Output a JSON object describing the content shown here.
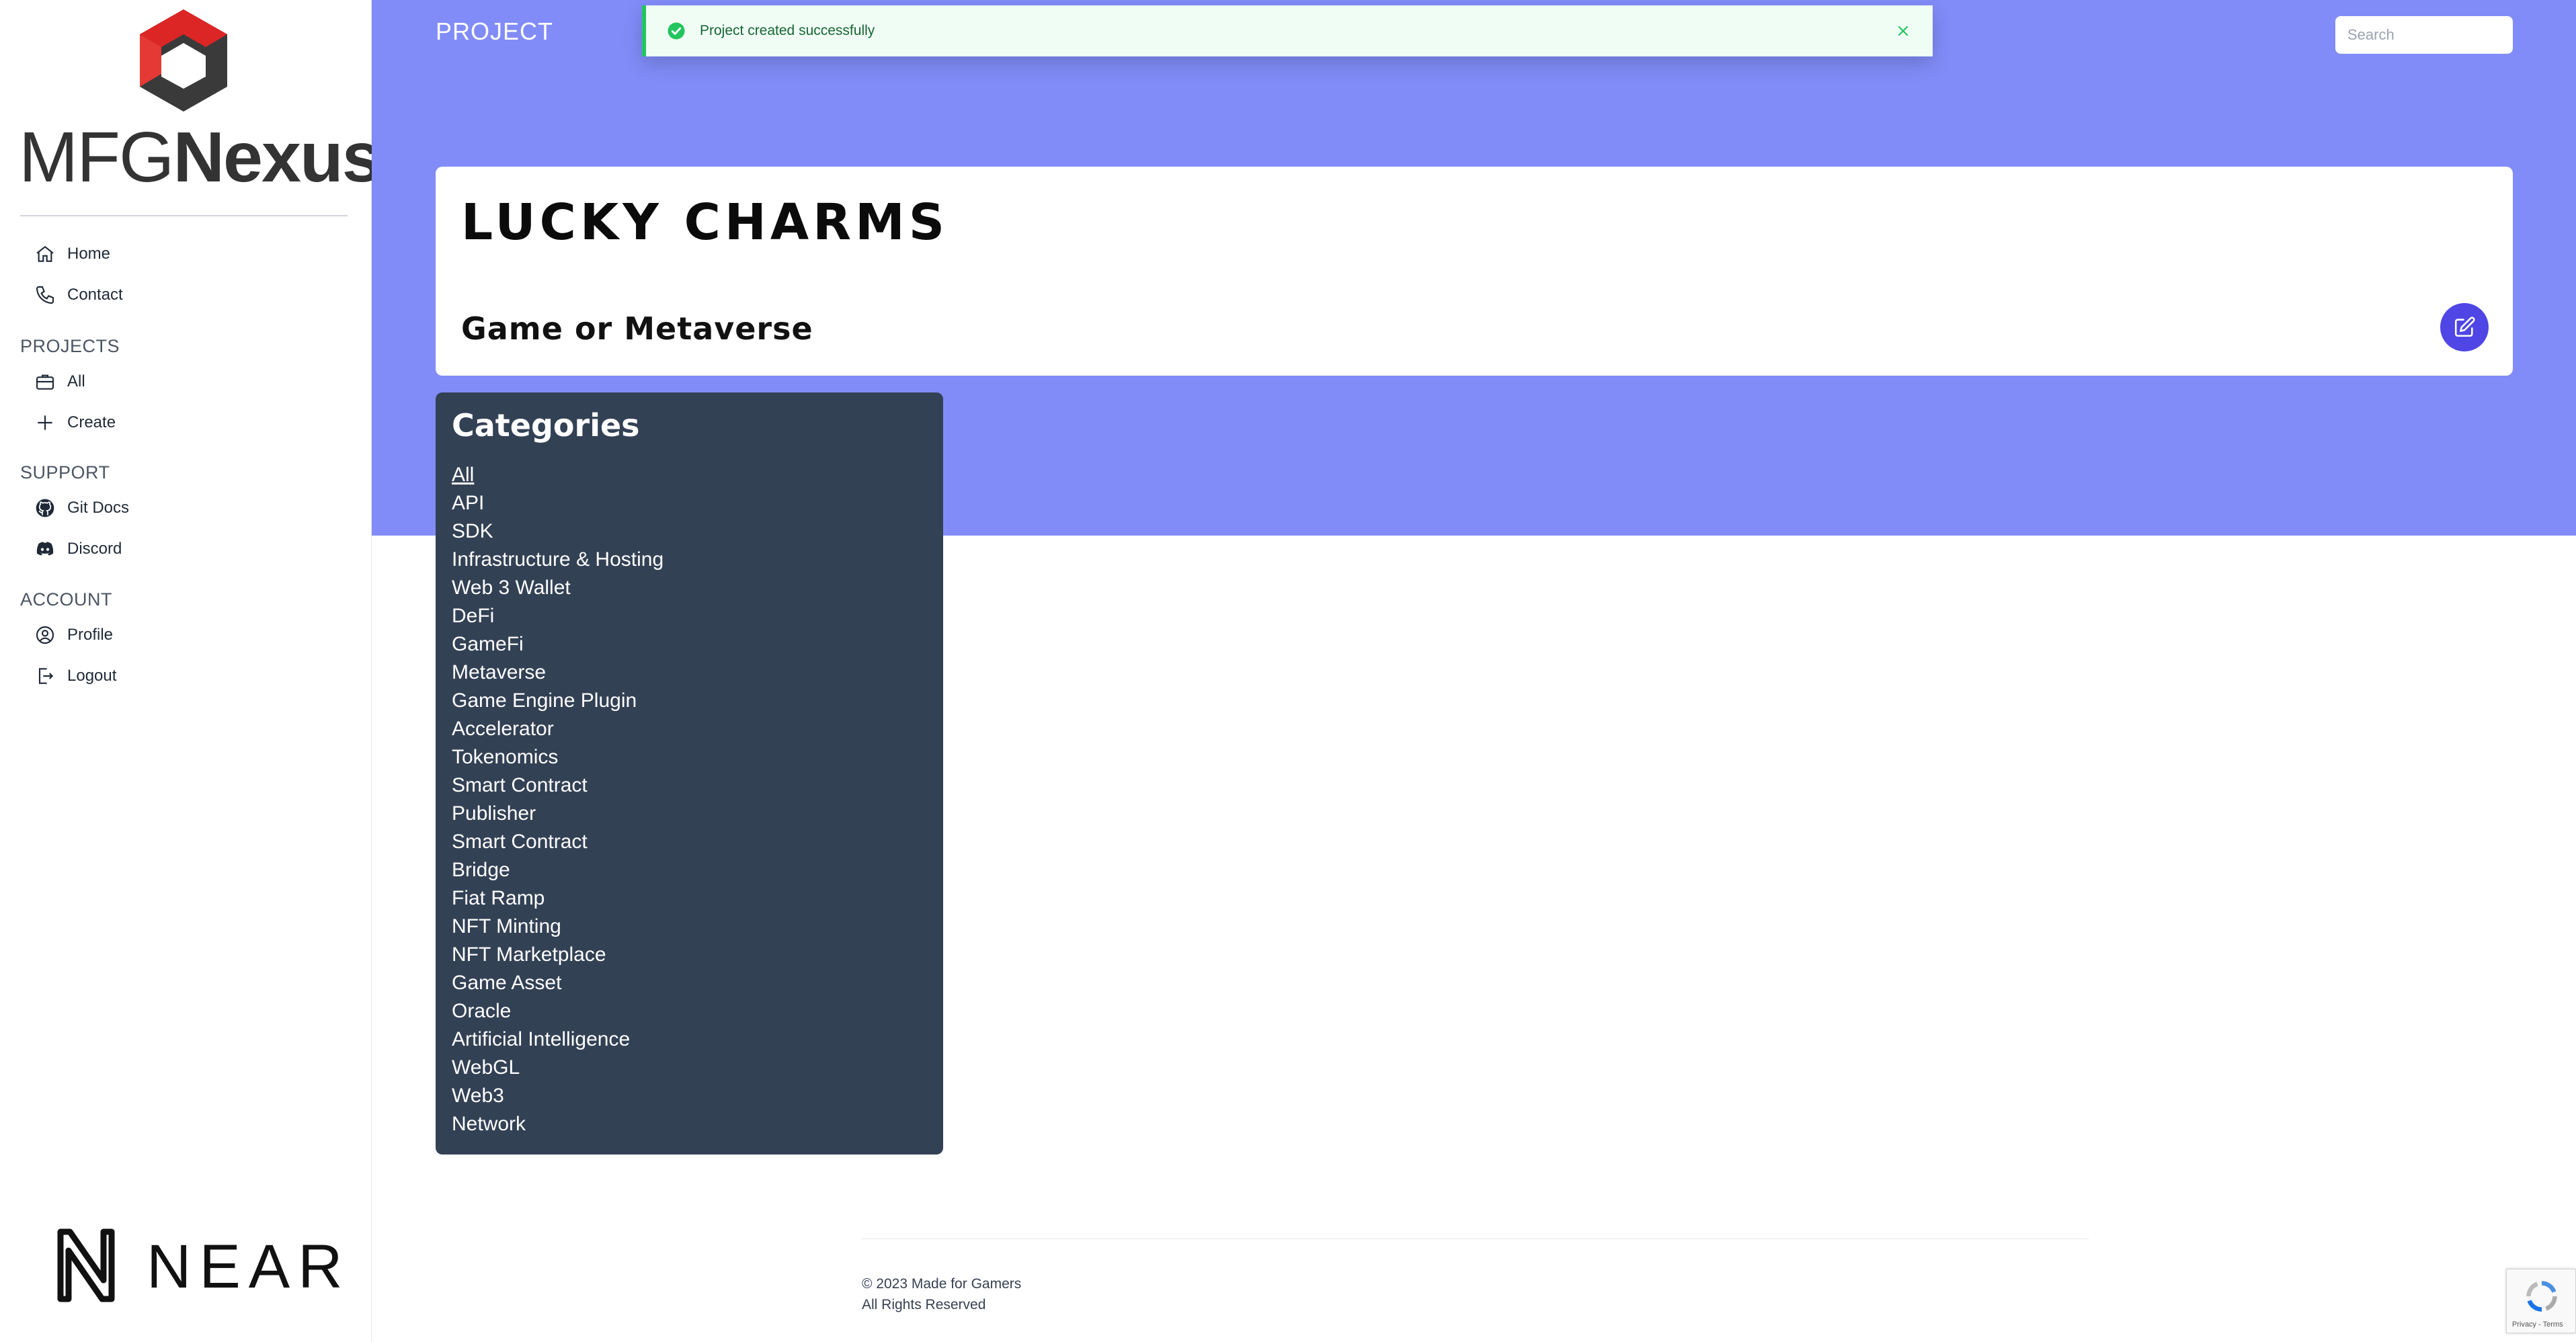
{
  "brand": {
    "name_light": "MFG",
    "name_bold": "Nexus",
    "partner": "NEAR"
  },
  "sidebar": {
    "top_items": [
      {
        "label": "Home",
        "icon": "home-icon"
      },
      {
        "label": "Contact",
        "icon": "phone-icon"
      }
    ],
    "sections": [
      {
        "title": "PROJECTS",
        "items": [
          {
            "label": "All",
            "icon": "briefcase-icon"
          },
          {
            "label": "Create",
            "icon": "plus-icon"
          }
        ]
      },
      {
        "title": "SUPPORT",
        "items": [
          {
            "label": "Git Docs",
            "icon": "github-icon"
          },
          {
            "label": "Discord",
            "icon": "discord-icon"
          }
        ]
      },
      {
        "title": "ACCOUNT",
        "items": [
          {
            "label": "Profile",
            "icon": "user-circle-icon"
          },
          {
            "label": "Logout",
            "icon": "logout-icon"
          }
        ]
      }
    ]
  },
  "header": {
    "breadcrumb": "PROJECT",
    "search_placeholder": "Search"
  },
  "toast": {
    "message": "Project created successfully",
    "status": "success",
    "color": "#22c55e"
  },
  "project": {
    "title": "LUCKY CHARMS",
    "type": "Game or Metaverse"
  },
  "categories": {
    "title": "Categories",
    "active_index": 0,
    "items": [
      "All",
      "API",
      "SDK",
      "Infrastructure & Hosting",
      "Web 3 Wallet",
      "DeFi",
      "GameFi",
      "Metaverse",
      "Game Engine Plugin",
      "Accelerator",
      "Tokenomics",
      "Smart Contract",
      "Publisher",
      "Smart Contract",
      "Bridge",
      "Fiat Ramp",
      "NFT Minting",
      "NFT Marketplace",
      "Game Asset",
      "Oracle",
      "Artificial Intelligence",
      "WebGL",
      "Web3",
      "Network"
    ]
  },
  "footer": {
    "copyright": "© 2023 Made for Gamers",
    "rights": "All Rights Reserved"
  },
  "recaptcha": {
    "text": "Privacy - Terms"
  },
  "colors": {
    "band": "#818cf8",
    "accent": "#4f46e5",
    "panel": "#334155",
    "logo_red": "#dc2626"
  }
}
